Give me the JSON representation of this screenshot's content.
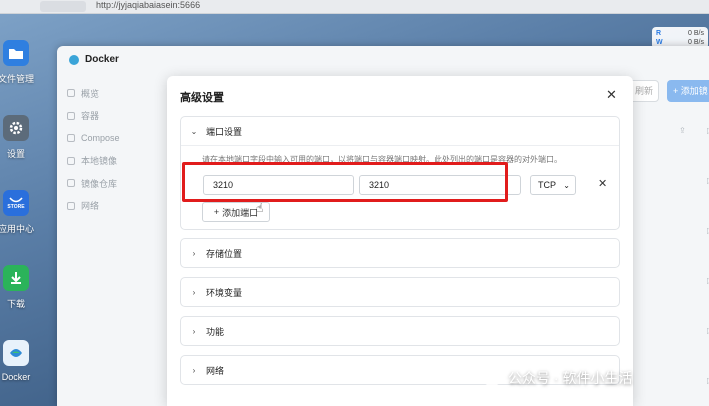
{
  "browser": {
    "url": "http://jyjaqiabaiasein:5666"
  },
  "net_widget": {
    "r_label": "R",
    "r_value": "0",
    "r_unit": "B/s",
    "w_label": "W",
    "w_value": "0",
    "w_unit": "B/s"
  },
  "desktop": [
    {
      "label": "文件管理",
      "icon": "folder-icon",
      "color": "#2f7fe0"
    },
    {
      "label": "设置",
      "icon": "gear-icon",
      "color": "#5c6b7a"
    },
    {
      "label": "应用中心",
      "icon": "store-icon",
      "color": "#2a6fdc",
      "badge": "STORE"
    },
    {
      "label": "下载",
      "icon": "download-icon",
      "color": "#2bb35a"
    },
    {
      "label": "Docker",
      "icon": "docker-icon",
      "color": "#2e8bd6"
    }
  ],
  "docker": {
    "title": "Docker",
    "nav": [
      {
        "label": "概览",
        "icon": "overview-icon"
      },
      {
        "label": "容器",
        "icon": "container-icon"
      },
      {
        "label": "Compose",
        "icon": "compose-icon"
      },
      {
        "label": "本地镜像",
        "icon": "image-icon"
      },
      {
        "label": "镜像仓库",
        "icon": "registry-icon"
      },
      {
        "label": "网络",
        "icon": "network-icon"
      }
    ],
    "refresh_label": "刷新",
    "add_label": "+ 添加镜"
  },
  "modal": {
    "title": "高级设置",
    "sections": [
      {
        "label": "端口设置",
        "expanded": true
      },
      {
        "label": "存储位置",
        "expanded": false
      },
      {
        "label": "环境变量",
        "expanded": false
      },
      {
        "label": "功能",
        "expanded": false
      },
      {
        "label": "网络",
        "expanded": false
      }
    ],
    "port": {
      "hint": "请在本地端口字段中输入可用的端口，以将端口与容器端口映射。此处列出的端口是容器的对外端口。",
      "host_port": "3210",
      "container_port": "3210",
      "protocol": "TCP",
      "add_label": "添加端口"
    }
  },
  "watermark": "公众号 · 软件小生活",
  "colors": {
    "highlight": "#e11c1c",
    "accent": "#8ab9ef"
  }
}
